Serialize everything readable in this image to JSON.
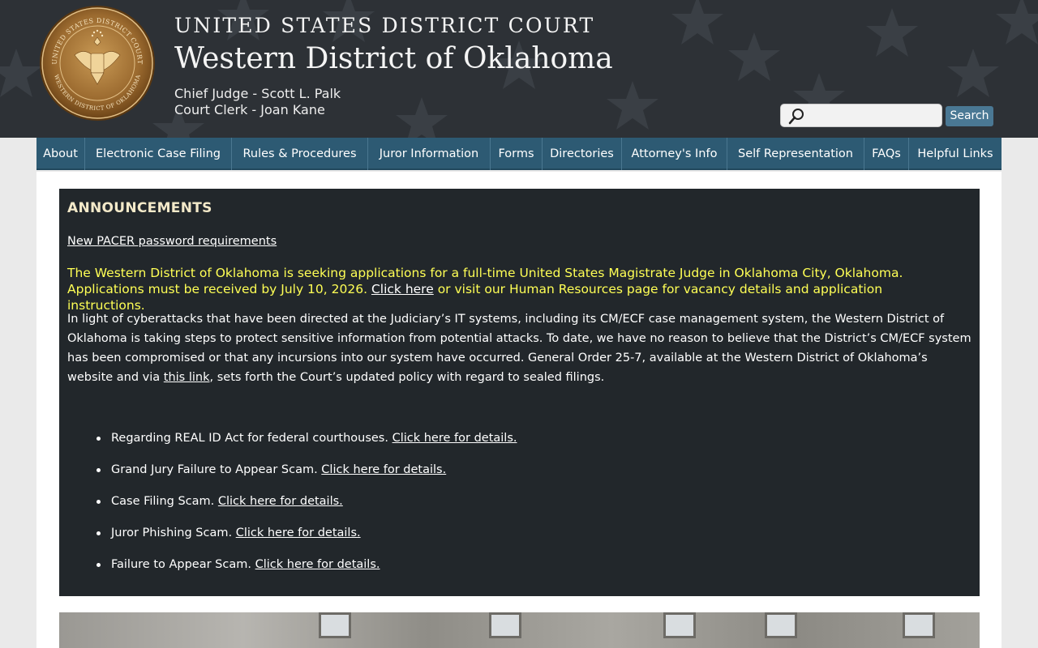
{
  "header": {
    "court_name": "UNITED STATES DISTRICT COURT",
    "district_name": "Western District of Oklahoma",
    "chief_judge": "Chief Judge - Scott L. Palk",
    "court_clerk": "Court Clerk - Joan Kane",
    "seal_top_text": "UNITED STATES DISTRICT COURT",
    "seal_bottom_text": "WESTERN DISTRICT OF OKLAHOMA"
  },
  "search": {
    "placeholder": "",
    "value": "",
    "button_label": "Search"
  },
  "nav": {
    "items": [
      {
        "label": "About"
      },
      {
        "label": "Electronic Case Filing"
      },
      {
        "label": "Rules & Procedures"
      },
      {
        "label": "Juror Information"
      },
      {
        "label": "Forms"
      },
      {
        "label": "Directories"
      },
      {
        "label": "Attorney's Info"
      },
      {
        "label": "Self Representation"
      },
      {
        "label": "FAQs"
      },
      {
        "label": "Helpful Links"
      }
    ]
  },
  "announcements": {
    "heading": "ANNOUNCEMENTS",
    "pacer_link": "New PACER password requirements",
    "notice_text_1": "The Western District of Oklahoma is seeking applications for a full-time United States Magistrate Judge in Oklahoma City, Oklahoma. Applications must be received by July 10, 2026.",
    "notice_link": "Click here",
    "notice_text_2": "or visit our Human Resources page for vacancy details and application instructions.",
    "cyber_text_1": "In light of cyberattacks that have been directed at the Judiciary’s IT systems, including its CM/ECF case management system, the Western District of Oklahoma is taking steps to protect sensitive information from potential attacks. To date, we have no reason to believe that the District’s CM/ECF system has been compromised or that any incursions into our system have occurred. General Order 25-7, available at the Western District of Oklahoma’s website and via",
    "cyber_link": "this link",
    "cyber_text_2": ", sets forth the Court’s updated policy with regard to sealed filings.",
    "bullets": [
      {
        "text": "Regarding REAL ID Act for federal courthouses.",
        "link": "Click here for details."
      },
      {
        "text": "Grand Jury Failure to Appear Scam.",
        "link": "Click here for details."
      },
      {
        "text": "Case Filing Scam.",
        "link": "Click here for details."
      },
      {
        "text": "Juror Phishing Scam.",
        "link": "Click here for details."
      },
      {
        "text": "Failure to Appear Scam.",
        "link": "Click here for details."
      }
    ]
  },
  "colors": {
    "header_bg": "#2d3136",
    "nav_bg": "#2d5a73",
    "announcement_bg": "#22272b",
    "notice_text": "#ffff55",
    "heading_text": "#f3e9c9",
    "search_button": "#4a7894"
  },
  "icons": {
    "search": "magnifier-icon",
    "seal": "great-seal-eagle"
  }
}
